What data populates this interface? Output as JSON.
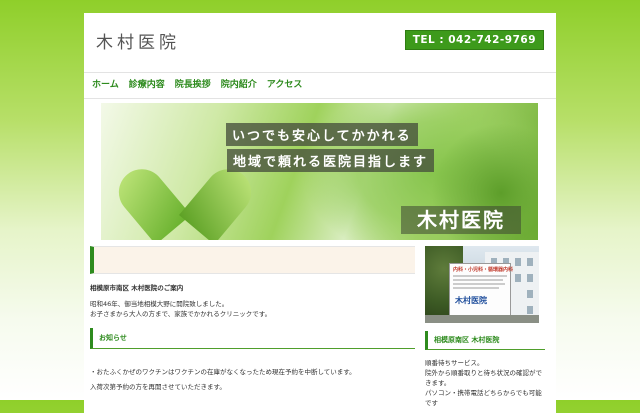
{
  "header": {
    "site_title": "木村医院",
    "tel": "TEL : 042-742-9769"
  },
  "nav": {
    "items": [
      {
        "label": "ホーム"
      },
      {
        "label": "診療内容"
      },
      {
        "label": "院長挨拶"
      },
      {
        "label": "院内紹介"
      },
      {
        "label": "アクセス"
      }
    ]
  },
  "hero": {
    "line1": "いつでも安心してかかれる",
    "line2": "地域で頼れる医院目指します",
    "logo": "木村医院"
  },
  "main": {
    "intro_title": "相模原市南区 木村医院のご案内",
    "intro_line1": "昭和46年、御当地相模大野に開院致しました。",
    "intro_line2": "お子さまから大人の方まで、家族でかかれるクリニックです。",
    "notice_heading": "お知らせ",
    "notice_line1": "・おたふくかぜのワクチンはワクチンの在庫がなくなったため現在予約を中断しています。",
    "notice_line2": "入荷次第予約の方を再開させていただきます。"
  },
  "sidebar": {
    "photo_sign_top": "内科・小児科・循環器内科",
    "photo_sign_name": "木村医院",
    "title": "相模原南区 木村医院",
    "line1": "順番待ちサービス。",
    "line2": "院外から順番取りと待ち状況の確認ができます。",
    "line3": "パソコン・携帯電話どちらからでも可能です"
  },
  "colors": {
    "accent": "#2e8b1e",
    "tel_bg": "#3d9a1b",
    "section_bg": "#fbf3e9"
  }
}
